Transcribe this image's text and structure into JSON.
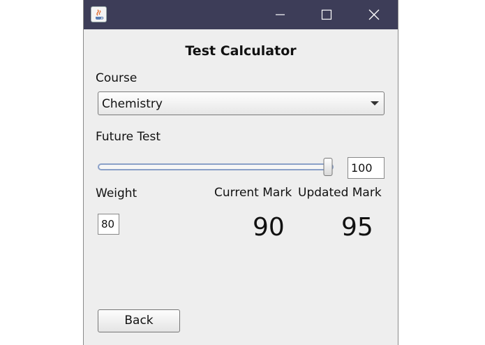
{
  "window": {
    "title": "Test Calculator",
    "titlebar_color": "#3d3d58",
    "background": "#eeeeee",
    "icons": {
      "app": "java-coffee-cup-icon",
      "minimize": "minimize-icon",
      "maximize": "maximize-icon",
      "close": "close-icon"
    }
  },
  "course": {
    "label": "Course",
    "selected": "Chemistry"
  },
  "future_test": {
    "label": "Future Test",
    "slider_value": 100,
    "slider_min": 0,
    "slider_max": 100,
    "field_value": "100"
  },
  "weight": {
    "label": "Weight",
    "value": "80"
  },
  "marks": {
    "current_label": "Current Mark",
    "current_value": "90",
    "updated_label": "Updated Mark",
    "updated_value": "95"
  },
  "actions": {
    "back_label": "Back"
  }
}
